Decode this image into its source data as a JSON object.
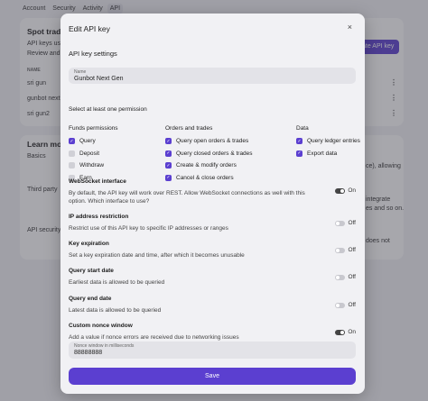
{
  "background": {
    "tabs": [
      "Account",
      "Security",
      "Activity",
      "API"
    ],
    "spot_title": "Spot trading",
    "api_keys_text": "API keys use",
    "review_text": "Review and m",
    "create_button": "ate API key",
    "name_col": "NAME",
    "rows": [
      "sri gun",
      "gunbot next ge",
      "sri gun2"
    ],
    "learn_more": "Learn more",
    "basics": "Basics",
    "third_party": "Third party",
    "api_security": "API security",
    "right_frag_1": "ce), allowing",
    "right_frag_2": "integrate",
    "right_frag_3": "es and so on.",
    "right_frag_4": "does not"
  },
  "modal": {
    "title": "Edit API key",
    "close_glyph": "×",
    "section_title": "API key settings",
    "name_field": {
      "label": "Name",
      "value": "Gunbot Next Gen"
    },
    "permission_hint": "Select at least one permission",
    "columns": [
      {
        "heading": "Funds permissions",
        "items": [
          {
            "label": "Query",
            "checked": true
          },
          {
            "label": "Deposit",
            "checked": false
          },
          {
            "label": "Withdraw",
            "checked": false
          },
          {
            "label": "Earn",
            "checked": false
          }
        ]
      },
      {
        "heading": "Orders and trades",
        "items": [
          {
            "label": "Query open orders & trades",
            "checked": true
          },
          {
            "label": "Query closed orders & trades",
            "checked": true
          },
          {
            "label": "Create & modify orders",
            "checked": true
          },
          {
            "label": "Cancel & close orders",
            "checked": true
          }
        ]
      },
      {
        "heading": "Data",
        "items": [
          {
            "label": "Query ledger entries",
            "checked": true
          },
          {
            "label": "Export data",
            "checked": true
          }
        ]
      }
    ],
    "settings": [
      {
        "title": "WebSocket interface",
        "desc": "By default, the API key will work over REST. Allow WebSocket connections as well with this option. Which interface to use?",
        "state": "On"
      },
      {
        "title": "IP address restriction",
        "desc": "Restrict use of this API key to specific IP addresses or ranges",
        "state": "Off"
      },
      {
        "title": "Key expiration",
        "desc": "Set a key expiration date and time, after which it becomes unusable",
        "state": "Off"
      },
      {
        "title": "Query start date",
        "desc": "Earliest data is allowed to be queried",
        "state": "Off"
      },
      {
        "title": "Query end date",
        "desc": "Latest data is allowed to be queried",
        "state": "Off"
      },
      {
        "title": "Custom nonce window",
        "desc": "Add a value if nonce errors are received due to networking issues",
        "state": "On"
      }
    ],
    "nonce_field": {
      "label": "Nonce window in milliseconds",
      "value": "88888888"
    },
    "save_label": "Save"
  },
  "colors": {
    "accent": "#5b3fd0",
    "toggle_on": "#444444",
    "toggle_off": "#c8c8ce"
  }
}
